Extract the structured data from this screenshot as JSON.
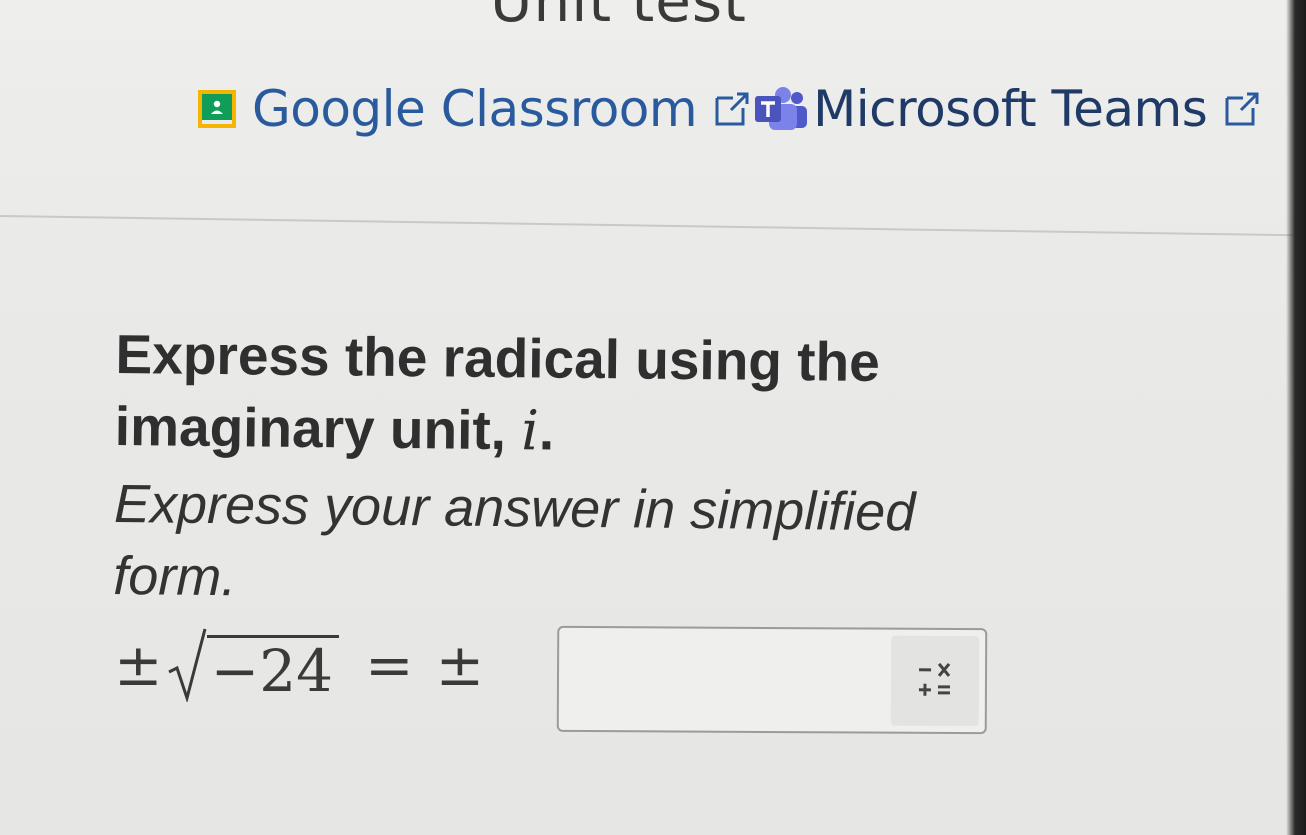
{
  "page": {
    "title": "Unit test"
  },
  "share": {
    "google_classroom_label": "Google Classroom",
    "google_classroom_icon": "google-classroom-icon",
    "microsoft_teams_label": "Microsoft Teams",
    "microsoft_teams_icon": "microsoft-teams-icon",
    "external_link_icon": "external-link-icon",
    "link_color": "#2a5a9e"
  },
  "question": {
    "prompt_text": "Express the radical using the imaginary unit, ",
    "prompt_var": "i",
    "prompt_end": ".",
    "instruction": "Express your answer in simplified form.",
    "equation": {
      "lhs_sign": "±",
      "radicand": "−24",
      "equals": "=",
      "rhs_sign": "±"
    },
    "answer": {
      "value": "",
      "placeholder": ""
    },
    "keypad_icon": "math-keypad-icon"
  }
}
